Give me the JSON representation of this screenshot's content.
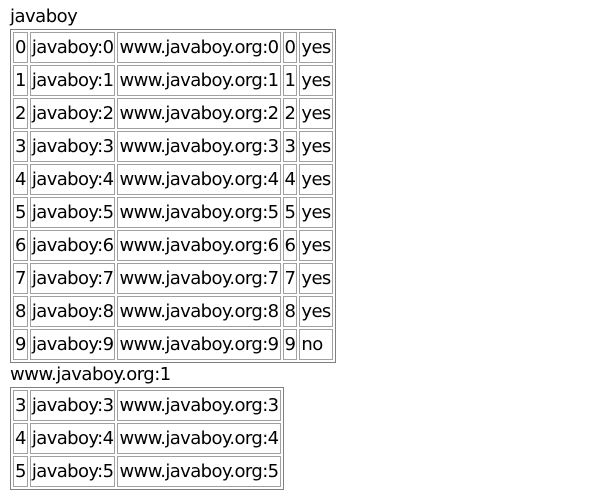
{
  "heading1": "javaboy",
  "table1": {
    "rows": [
      [
        "0",
        "javaboy:0",
        "www.javaboy.org:0",
        "0",
        "yes"
      ],
      [
        "1",
        "javaboy:1",
        "www.javaboy.org:1",
        "1",
        "yes"
      ],
      [
        "2",
        "javaboy:2",
        "www.javaboy.org:2",
        "2",
        "yes"
      ],
      [
        "3",
        "javaboy:3",
        "www.javaboy.org:3",
        "3",
        "yes"
      ],
      [
        "4",
        "javaboy:4",
        "www.javaboy.org:4",
        "4",
        "yes"
      ],
      [
        "5",
        "javaboy:5",
        "www.javaboy.org:5",
        "5",
        "yes"
      ],
      [
        "6",
        "javaboy:6",
        "www.javaboy.org:6",
        "6",
        "yes"
      ],
      [
        "7",
        "javaboy:7",
        "www.javaboy.org:7",
        "7",
        "yes"
      ],
      [
        "8",
        "javaboy:8",
        "www.javaboy.org:8",
        "8",
        "yes"
      ],
      [
        "9",
        "javaboy:9",
        "www.javaboy.org:9",
        "9",
        "no"
      ]
    ]
  },
  "heading2": "www.javaboy.org:1",
  "table2": {
    "rows": [
      [
        "3",
        "javaboy:3",
        "www.javaboy.org:3"
      ],
      [
        "4",
        "javaboy:4",
        "www.javaboy.org:4"
      ],
      [
        "5",
        "javaboy:5",
        "www.javaboy.org:5"
      ]
    ]
  }
}
